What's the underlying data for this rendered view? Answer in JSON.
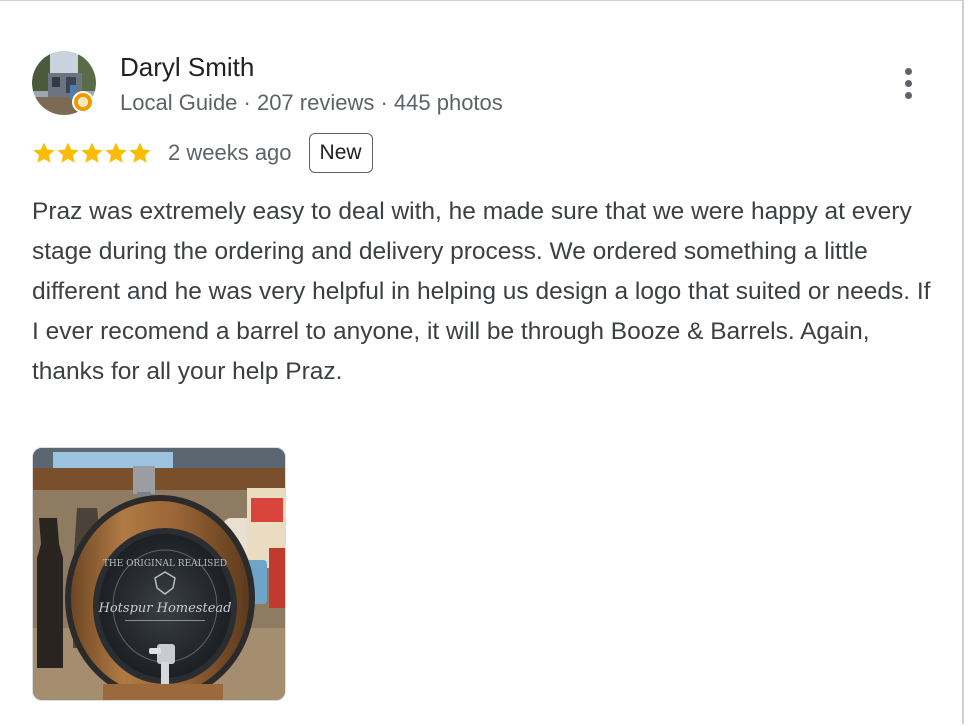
{
  "reviewer": {
    "name": "Daryl Smith",
    "meta": "Local Guide · 207 reviews · 445 photos",
    "avatar_icon": "reviewer-avatar-photo",
    "badge_icon": "local-guide-badge-icon"
  },
  "menu": {
    "icon": "more-vertical-icon"
  },
  "review": {
    "rating": 5,
    "rating_max": 5,
    "date": "2 weeks ago",
    "badge": "New",
    "text": "Praz was extremely easy to deal with, he made sure that we were happy at every stage during the ordering and delivery process. We ordered something a little different and he was very helpful in helping us design a logo that suited or needs. If I ever recomend a barrel to anyone, it will be through Booze & Barrels. Again, thanks for all your help Praz.",
    "photo": {
      "engraving_top": "THE ORIGINAL REALISED",
      "engraving_main": "Hotspur Homestead"
    }
  },
  "colors": {
    "star": "#fbbc04",
    "text_primary": "#202124",
    "text_secondary": "#5f6368",
    "guide_badge": "#f29900"
  }
}
